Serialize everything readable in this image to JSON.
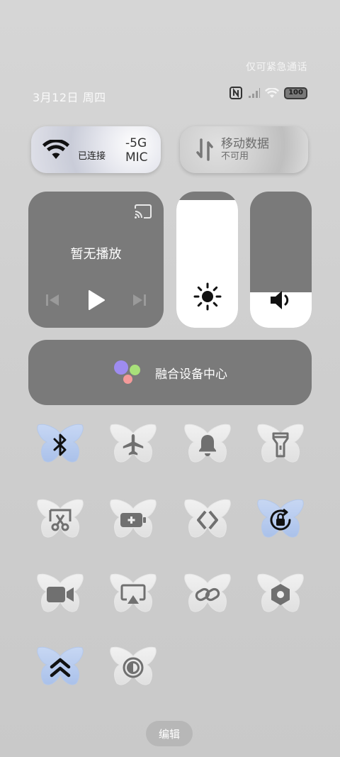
{
  "status": {
    "emergency_text": "仅可紧急通话",
    "date": "3月12日 周四",
    "battery": "100"
  },
  "wifi": {
    "status": "已连接",
    "ssid": "-5G MIC"
  },
  "mobile_data": {
    "title": "移动数据",
    "status": "不可用"
  },
  "media": {
    "title": "暂无播放"
  },
  "brightness": {
    "level_percent": 94
  },
  "volume": {
    "level_percent": 26
  },
  "fusion": {
    "label": "融合设备中心"
  },
  "toggles": [
    {
      "name": "bluetooth",
      "icon": "bluetooth-icon",
      "active": true
    },
    {
      "name": "airplane-mode",
      "icon": "airplane-icon",
      "active": false
    },
    {
      "name": "silent-mode",
      "icon": "bell-icon",
      "active": false
    },
    {
      "name": "flashlight",
      "icon": "flashlight-icon",
      "active": false
    },
    {
      "name": "screenshot",
      "icon": "scissors-icon",
      "active": false
    },
    {
      "name": "battery-saver",
      "icon": "battery-plus-icon",
      "active": false
    },
    {
      "name": "nearby-share",
      "icon": "share-arrows-icon",
      "active": false
    },
    {
      "name": "rotation-lock",
      "icon": "rotation-lock-icon",
      "active": true
    },
    {
      "name": "screen-record",
      "icon": "video-camera-icon",
      "active": false
    },
    {
      "name": "screen-cast",
      "icon": "cast-icon",
      "active": false
    },
    {
      "name": "link",
      "icon": "link-icon",
      "active": false
    },
    {
      "name": "settings-hex",
      "icon": "hexagon-icon",
      "active": false
    },
    {
      "name": "performance-mode",
      "icon": "double-chevron-up-icon",
      "active": true
    },
    {
      "name": "dark-mode",
      "icon": "contrast-icon",
      "active": false
    }
  ],
  "edit_label": "编辑",
  "colors": {
    "tile_active": "#b9cdf0",
    "tile_inactive": "#ededed",
    "card": "#7a7a7a"
  }
}
